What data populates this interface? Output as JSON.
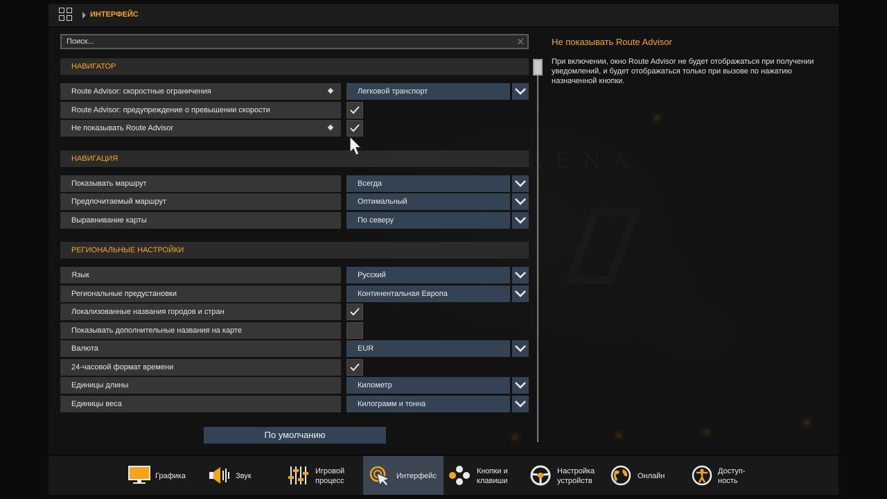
{
  "breadcrumb": "ИНТЕРФЕЙС",
  "search": {
    "value": "Поиск..."
  },
  "sections": [
    {
      "title": "НАВИГАТОР",
      "rows": [
        {
          "label": "Route Advisor: скоростные ограничения",
          "type": "select",
          "value": "Легковой транспорт",
          "diamond": true
        },
        {
          "label": "Route Advisor: предупреждение о превышении скорости",
          "type": "check",
          "checked": true,
          "diamond": false
        },
        {
          "label": "Не показывать Route Advisor",
          "type": "check",
          "checked": true,
          "diamond": true
        }
      ]
    },
    {
      "title": "НАВИГАЦИЯ",
      "rows": [
        {
          "label": "Показывать маршрут",
          "type": "select",
          "value": "Всегда"
        },
        {
          "label": "Предпочитаемый маршрут",
          "type": "select",
          "value": "Оптимальный"
        },
        {
          "label": "Выравнивание карты",
          "type": "select",
          "value": "По северу"
        }
      ]
    },
    {
      "title": "РЕГИОНАЛЬНЫЕ НАСТРОЙКИ",
      "rows": [
        {
          "label": "Язык",
          "type": "select",
          "value": "Русский"
        },
        {
          "label": "Региональные предустановки",
          "type": "select",
          "value": "Континентальная Европа"
        },
        {
          "label": "Локализованные названия городов и стран",
          "type": "check",
          "checked": true
        },
        {
          "label": "Показывать дополнительные названия на карте",
          "type": "check",
          "checked": false
        },
        {
          "label": "Валюта",
          "type": "select",
          "value": "EUR"
        },
        {
          "label": "24-часовой формат времени",
          "type": "check",
          "checked": true
        },
        {
          "label": "Единицы длины",
          "type": "select",
          "value": "Километр"
        },
        {
          "label": "Единицы веса",
          "type": "select",
          "value": "Килограмм и тонна"
        }
      ]
    }
  ],
  "default_button": "По умолчанию",
  "help": {
    "title": "Не показывать Route Advisor",
    "text": "При включении, окно Route Advisor не будет отображаться при получении уведомлений, и будет отображаться только при вызове по нажатию назначенной кнопки."
  },
  "bottom_nav": [
    {
      "id": "graphics",
      "line1": "Графика",
      "line2": "",
      "icon": "monitor-icon",
      "active": false
    },
    {
      "id": "sound",
      "line1": "Звук",
      "line2": "",
      "icon": "speaker-icon",
      "active": false
    },
    {
      "id": "gameplay",
      "line1": "Игровой",
      "line2": "процесс",
      "icon": "sliders-icon",
      "active": false
    },
    {
      "id": "interface",
      "line1": "Интерфейс",
      "line2": "",
      "icon": "cursor-icon",
      "active": true
    },
    {
      "id": "keys",
      "line1": "Кнопки и",
      "line2": "клавиши",
      "icon": "gamepad-buttons-icon",
      "active": false
    },
    {
      "id": "devices",
      "line1": "Настройка",
      "line2": "устройств",
      "icon": "steering-wheel-icon",
      "active": false
    },
    {
      "id": "online",
      "line1": "Онлайн",
      "line2": "",
      "icon": "globe-icon",
      "active": false
    },
    {
      "id": "access",
      "line1": "Доступ-",
      "line2": "ность",
      "icon": "accessibility-icon",
      "active": false
    }
  ],
  "colors": {
    "accent": "#f3a71a",
    "select_bg": "#334354",
    "row_bg": "#363636",
    "active_tab": "#3c4552"
  }
}
